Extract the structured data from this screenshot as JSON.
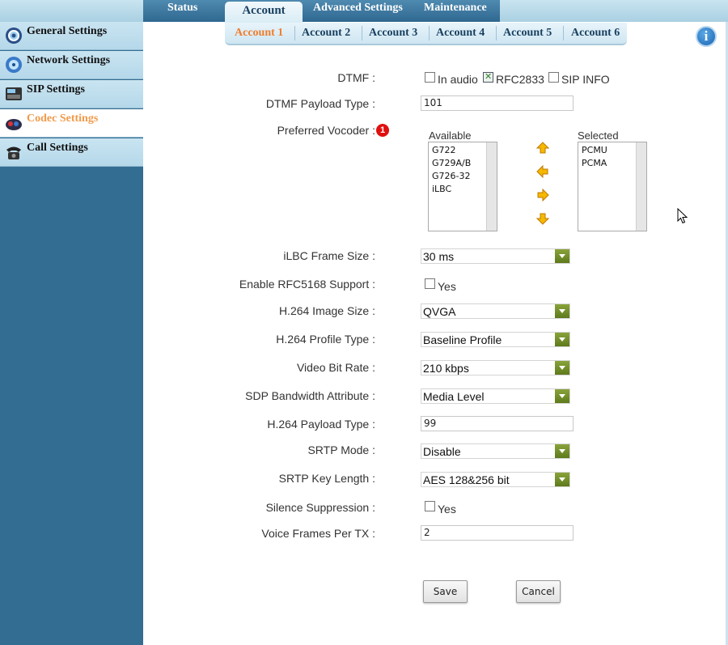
{
  "top_tabs": [
    "Status",
    "Account",
    "Advanced Settings",
    "Maintenance"
  ],
  "sidebar": {
    "items": [
      {
        "label": "General Settings",
        "icon": "gear-icon"
      },
      {
        "label": "Network Settings",
        "icon": "network-globe-icon"
      },
      {
        "label": "SIP Settings",
        "icon": "sip-phone-icon"
      },
      {
        "label": "Codec Settings",
        "icon": "codec-icon"
      },
      {
        "label": "Call Settings",
        "icon": "telephone-icon"
      }
    ],
    "active": "Codec Settings"
  },
  "account_tabs": [
    "Account 1",
    "Account 2",
    "Account 3",
    "Account 4",
    "Account 5",
    "Account 6"
  ],
  "info_icon": "i",
  "form": {
    "dtmf": {
      "label": "DTMF :",
      "options": [
        {
          "label": "In audio",
          "checked": false
        },
        {
          "label": "RFC2833",
          "checked": true
        },
        {
          "label": "SIP INFO",
          "checked": false
        }
      ]
    },
    "dtmf_payload_type": {
      "label": "DTMF Payload Type :",
      "value": "101"
    },
    "preferred_vocoder": {
      "label": "Preferred Vocoder :",
      "badge": "1",
      "available_heading": "Available",
      "selected_heading": "Selected",
      "available": [
        "G722",
        "G729A/B",
        "G726-32",
        "iLBC"
      ],
      "selected": [
        "PCMU",
        "PCMA"
      ]
    },
    "ilbc_frame_size": {
      "label": "iLBC Frame Size :",
      "value": "30 ms"
    },
    "enable_rfc5168": {
      "label": "Enable RFC5168 Support :",
      "option": "Yes",
      "checked": false
    },
    "h264_image_size": {
      "label": "H.264 Image Size :",
      "value": "QVGA"
    },
    "h264_profile_type": {
      "label": "H.264 Profile Type :",
      "value": "Baseline Profile"
    },
    "video_bit_rate": {
      "label": "Video Bit Rate :",
      "value": "210 kbps"
    },
    "sdp_bandwidth": {
      "label": "SDP Bandwidth Attribute :",
      "value": "Media Level"
    },
    "h264_payload_type": {
      "label": "H.264 Payload Type :",
      "value": "99"
    },
    "srtp_mode": {
      "label": "SRTP Mode :",
      "value": "Disable"
    },
    "srtp_key_length": {
      "label": "SRTP Key Length :",
      "value": "AES 128&256 bit"
    },
    "silence_suppression": {
      "label": "Silence Suppression :",
      "option": "Yes",
      "checked": false
    },
    "voice_frames_per_tx": {
      "label": "Voice Frames Per TX :",
      "value": "2"
    }
  },
  "buttons": {
    "save": "Save",
    "cancel": "Cancel"
  },
  "colors": {
    "sidebar_bg": "#346d92",
    "active_orange": "#ef7d2c",
    "select_arrow": "#6b8a24",
    "badge_red": "#e01010"
  }
}
